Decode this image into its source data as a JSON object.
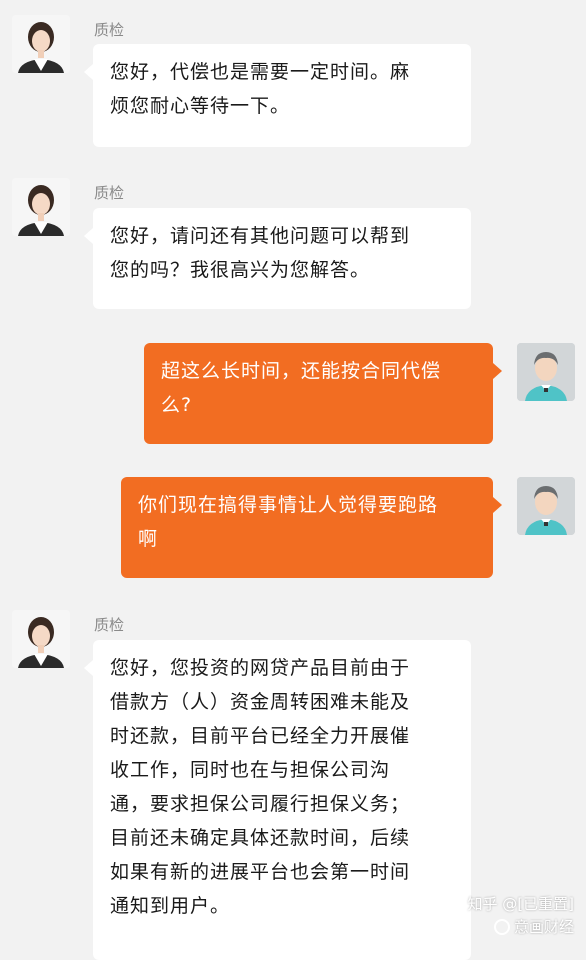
{
  "messages": [
    {
      "side": "agent",
      "sender": "质检",
      "text": "您好，代偿也是需要一定时间。麻\n烦您耐心等待一下。"
    },
    {
      "side": "agent",
      "sender": "质检",
      "text": "您好，请问还有其他问题可以帮到\n您的吗？我很高兴为您解答。"
    },
    {
      "side": "user",
      "text": "超这么长时间，还能按合同代偿\n么?"
    },
    {
      "side": "user",
      "text": "你们现在搞得事情让人觉得要跑路\n啊"
    },
    {
      "side": "agent",
      "sender": "质检",
      "text": "您好，您投资的网贷产品目前由于\n借款方（人）资金周转困难未能及\n时还款，目前平台已经全力开展催\n收工作，同时也在与担保公司沟\n通，要求担保公司履行担保义务；\n目前还未确定具体还款时间，后续\n如果有新的进展平台也会第一时间\n通知到用户。"
    }
  ],
  "watermark": {
    "line1": "知乎 @[已重置]",
    "line2": "意画财经"
  },
  "colors": {
    "user_bubble": "#f26d22",
    "agent_bubble": "#ffffff",
    "background": "#f2f2f2"
  }
}
